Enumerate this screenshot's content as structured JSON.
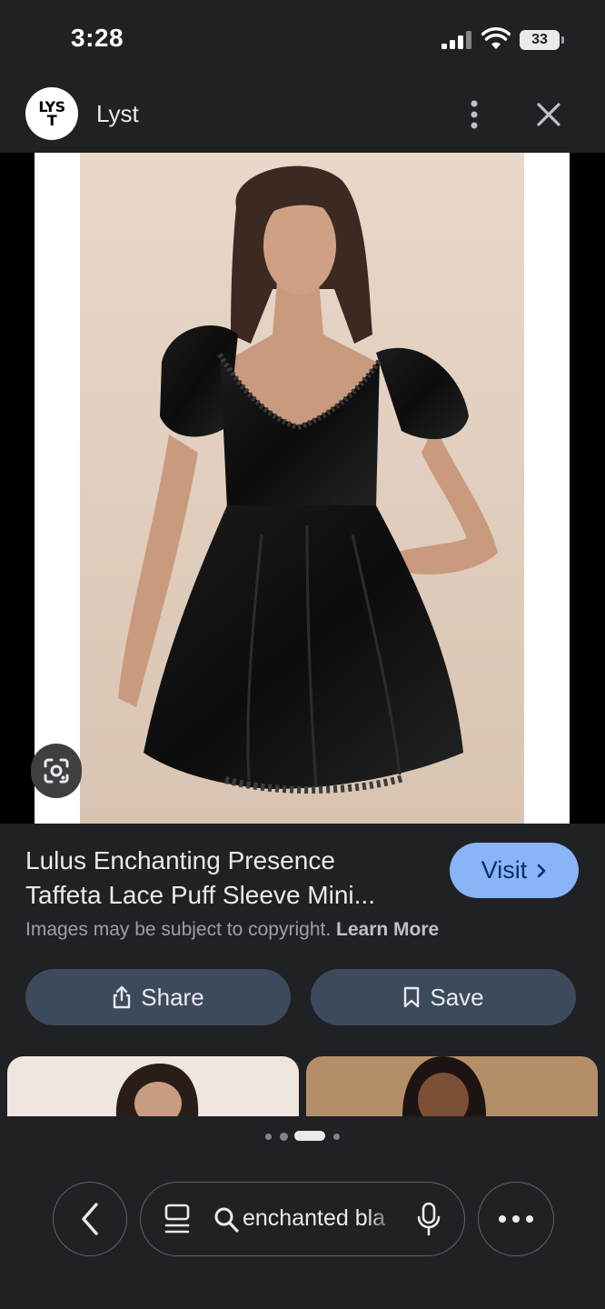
{
  "status_bar": {
    "time": "3:28",
    "battery": "33"
  },
  "header": {
    "logo_text": "LYST",
    "site_name": "Lyst",
    "icons": [
      "more-vertical-icon",
      "close-icon"
    ]
  },
  "product": {
    "title_line1": "Lulus Enchanting Presence",
    "title_line2": "Taffeta Lace Puff Sleeve Mini...",
    "visit_label": "Visit",
    "copyright_text": "Images may be subject to copyright.",
    "learn_more": "Learn More"
  },
  "actions": {
    "share_label": "Share",
    "save_label": "Save"
  },
  "pagination": {
    "total": 4,
    "active": 3
  },
  "bottom_bar": {
    "search_query": "enchanted bla"
  },
  "colors": {
    "background": "#202124",
    "visit_button": "#8ab4f8",
    "action_button": "#3c4a5c",
    "image_backdrop": "#e3d2c4"
  }
}
